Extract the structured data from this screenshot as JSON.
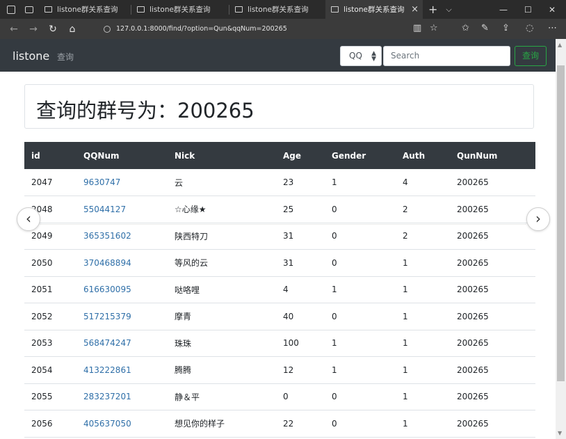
{
  "browser": {
    "tabs": [
      {
        "label": "listone群关系查询"
      },
      {
        "label": "listone群关系查询"
      },
      {
        "label": "listone群关系查询"
      },
      {
        "label": "listone群关系查询",
        "active": true
      }
    ],
    "address": "127.0.0.1:8000/find/?option=Qun&qqNum=200265"
  },
  "navbar": {
    "brand": "listone",
    "link": "查询",
    "select_value": "QQ",
    "search_placeholder": "Search",
    "search_button": "查询",
    "accent": "#28a745",
    "bg": "#343a40"
  },
  "page": {
    "heading": "查询的群号为：200265"
  },
  "table": {
    "headers": [
      "id",
      "QQNum",
      "Nick",
      "Age",
      "Gender",
      "Auth",
      "QunNum"
    ],
    "rows": [
      [
        "2047",
        "9630747",
        "云",
        "23",
        "1",
        "4",
        "200265"
      ],
      [
        "2048",
        "55044127",
        "☆心缘★",
        "25",
        "0",
        "2",
        "200265"
      ],
      [
        "2049",
        "365351602",
        "陕西特刀",
        "31",
        "0",
        "2",
        "200265"
      ],
      [
        "2050",
        "370468894",
        "等风的云",
        "31",
        "0",
        "1",
        "200265"
      ],
      [
        "2051",
        "616630095",
        "哒咯哩",
        "4",
        "1",
        "1",
        "200265"
      ],
      [
        "2052",
        "517215379",
        "摩青",
        "40",
        "0",
        "1",
        "200265"
      ],
      [
        "2053",
        "568474247",
        "珠珠",
        "100",
        "1",
        "1",
        "200265"
      ],
      [
        "2054",
        "413222861",
        "腾腾",
        "12",
        "1",
        "1",
        "200265"
      ],
      [
        "2055",
        "283237201",
        "静＆平",
        "0",
        "0",
        "1",
        "200265"
      ],
      [
        "2056",
        "405637050",
        "想见你的样子",
        "22",
        "0",
        "1",
        "200265"
      ]
    ]
  }
}
